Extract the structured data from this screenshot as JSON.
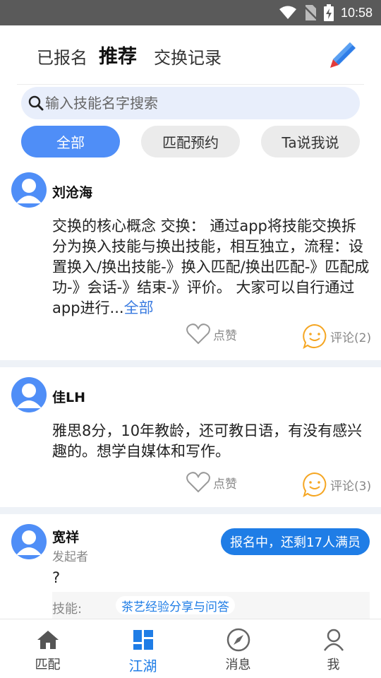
{
  "status_bar": {
    "time": "10:58"
  },
  "tabs": {
    "signed": "已报名",
    "recommend": "推荐",
    "exchange": "交换记录"
  },
  "search": {
    "placeholder": "输入技能名字搜索"
  },
  "filters": {
    "all": "全部",
    "match": "匹配预约",
    "ta": "Ta说我说"
  },
  "posts": [
    {
      "author": "刘沧海",
      "text": "交换的核心概念 交换： 通过app将技能交换拆分为换入技能与换出技能，相互独立，流程：设置换入/换出技能-》换入匹配/换出匹配-》匹配成功-》会话-》结束-》评价。 大家可以自行通过app进行...",
      "more": "全部",
      "like_label": "点赞",
      "comment_label": "评论(2)"
    },
    {
      "author": "佳LH",
      "text": "雅思8分，10年教龄，还可教日语，有没有感兴趣的。想学自媒体和写作。",
      "like_label": "点赞",
      "comment_label": "评论(3)"
    },
    {
      "author": "宽祥",
      "role": "发起者",
      "status": "报名中，还剩17人满员",
      "text": "?",
      "skill_label": "技能:",
      "skill_value": "茶艺经验分享与问答"
    }
  ],
  "bottom_nav": {
    "match": "匹配",
    "jianghu": "江湖",
    "messages": "消息",
    "me": "我"
  },
  "colors": {
    "accent": "#4f8ef7",
    "active_nav": "#1f7de6",
    "status_pill": "#1f7de6",
    "edit_icon": "#2f7de8"
  }
}
